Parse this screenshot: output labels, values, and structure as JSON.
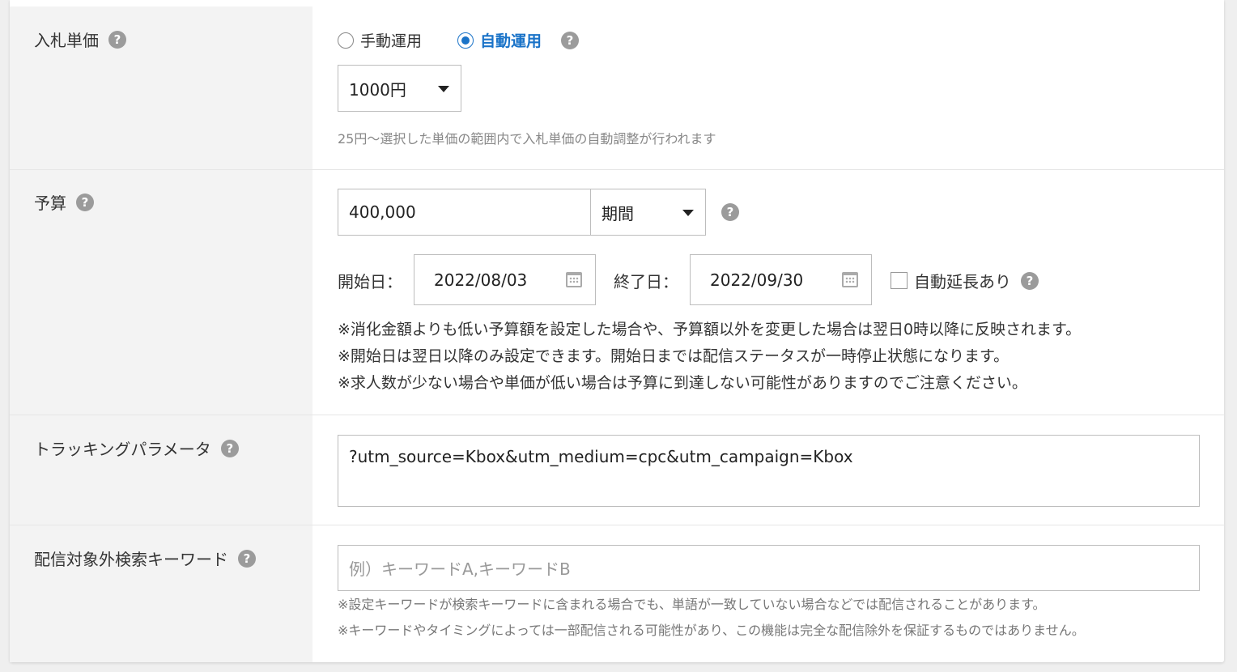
{
  "bid": {
    "label": "入札単価",
    "options": [
      "手動運用",
      "自動運用"
    ],
    "selected_option": "自動運用",
    "amount": "1000円",
    "hint": "25円～選択した単価の範囲内で入札単価の自動調整が行われます"
  },
  "budget": {
    "label": "予算",
    "amount": "400,000",
    "period": "期間",
    "start_label": "開始日：",
    "start_date": "2022/08/03",
    "end_label": "終了日：",
    "end_date": "2022/09/30",
    "auto_extend_label": "自動延長あり",
    "auto_extend_checked": false,
    "notes": [
      "※消化金額よりも低い予算額を設定した場合や、予算額以外を変更した場合は翌日0時以降に反映されます。",
      "※開始日は翌日以降のみ設定できます。開始日までは配信ステータスが一時停止状態になります。",
      "※求人数が少ない場合や単価が低い場合は予算に到達しない可能性がありますのでご注意ください。"
    ]
  },
  "tracking": {
    "label": "トラッキングパラメータ",
    "value": "?utm_source=Kbox&utm_medium=cpc&utm_campaign=Kbox"
  },
  "exclude_keywords": {
    "label": "配信対象外検索キーワード",
    "placeholder": "例）キーワードA,キーワードB",
    "notes": [
      "※設定キーワードが検索キーワードに含まれる場合でも、単語が一致していない場合などでは配信されることがあります。",
      "※キーワードやタイミングによっては一部配信される可能性があり、この機能は完全な配信除外を保証するものではありません。"
    ]
  },
  "help_glyph": "?",
  "colors": {
    "accent": "#1a73c8",
    "label_bg": "#f3f3f3",
    "help": "#9b9b9b"
  }
}
